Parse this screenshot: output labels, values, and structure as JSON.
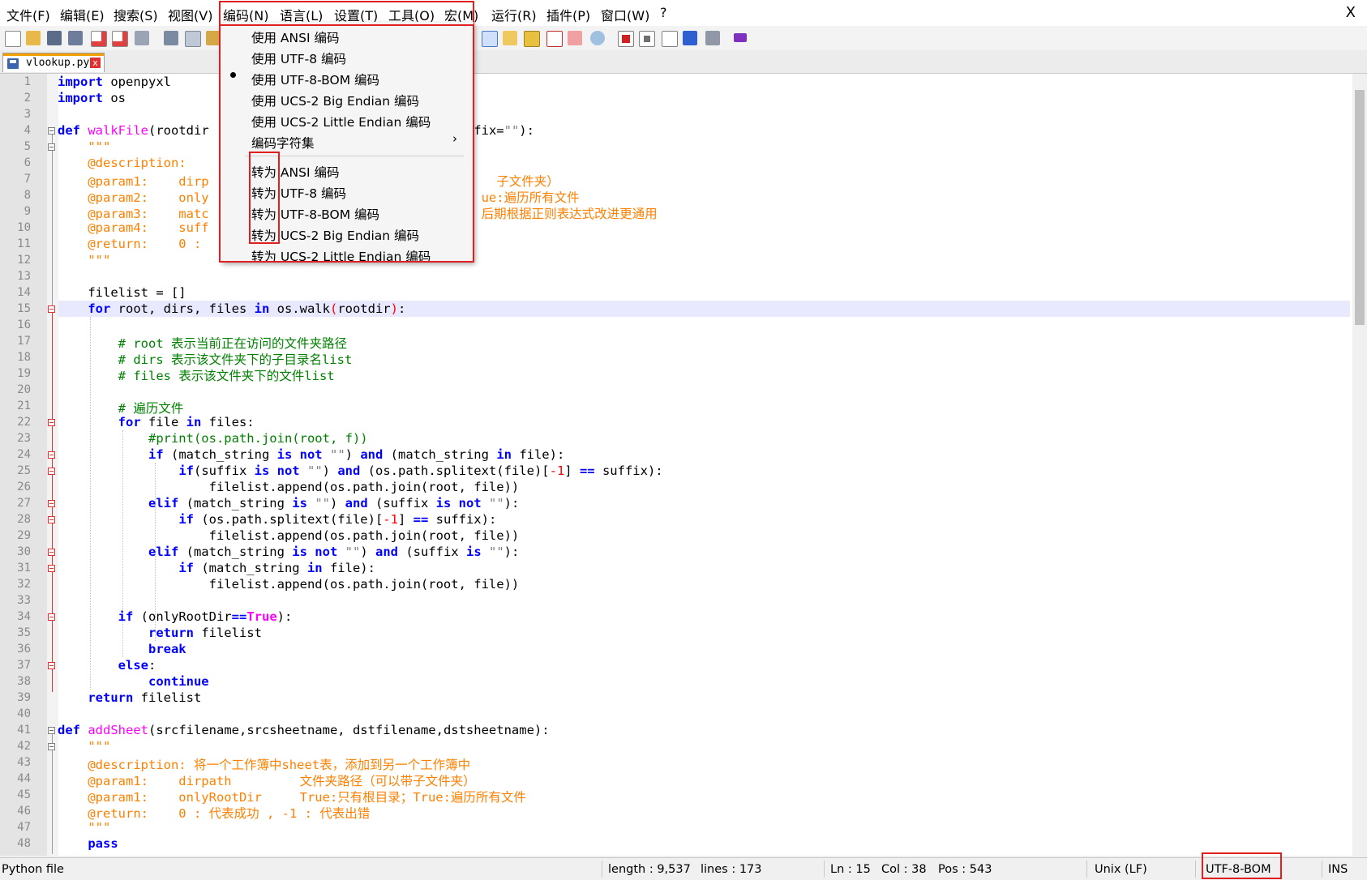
{
  "menu": {
    "file": "文件(F)",
    "edit": "编辑(E)",
    "search": "搜索(S)",
    "view": "视图(V)",
    "encoding": "编码(N)",
    "language": "语言(L)",
    "settings": "设置(T)",
    "tools": "工具(O)",
    "macro": "宏(M)",
    "run": "运行(R)",
    "plugins": "插件(P)",
    "window": "窗口(W)",
    "help": "?",
    "close": "X"
  },
  "tab": {
    "filename": "vlookup.py",
    "close": "x"
  },
  "encoding_menu": {
    "use_ansi": "使用 ANSI 编码",
    "use_utf8": "使用 UTF-8 编码",
    "use_utf8_bom": "使用 UTF-8-BOM 编码",
    "use_ucs2_be": "使用 UCS-2 Big Endian 编码",
    "use_ucs2_le": "使用 UCS-2 Little Endian 编码",
    "charset": "编码字符集",
    "charset_arrow": "›",
    "conv_ansi": "转为 ANSI 编码",
    "conv_utf8": "转为 UTF-8 编码",
    "conv_utf8_bom": "转为 UTF-8-BOM 编码",
    "conv_ucs2_be": "转为 UCS-2 Big Endian 编码",
    "conv_ucs2_le": "转为 UCS-2 Little Endian 编码",
    "selected": "use_utf8_bom"
  },
  "editor": {
    "line_numbers": [
      "1",
      "2",
      "3",
      "4",
      "5",
      "6",
      "7",
      "8",
      "9",
      "10",
      "11",
      "12",
      "13",
      "14",
      "15",
      "16",
      "17",
      "18",
      "19",
      "20",
      "21",
      "22",
      "23",
      "24",
      "25",
      "26",
      "27",
      "28",
      "29",
      "30",
      "31",
      "32",
      "33",
      "34",
      "35",
      "36",
      "37",
      "38",
      "39",
      "40",
      "41",
      "42",
      "43",
      "44",
      "45",
      "46",
      "47",
      "48"
    ],
    "current_line": "15"
  },
  "status": {
    "filetype": "Python file",
    "length": "length : 9,537",
    "lines": "lines : 173",
    "ln": "Ln : 15",
    "col": "Col : 38",
    "pos": "Pos : 543",
    "eol": "Unix (LF)",
    "encoding": "UTF-8-BOM",
    "mode": "INS"
  },
  "colors": {
    "keyword": "#0000ff",
    "function_name": "#ff00ff",
    "comment": "#008000",
    "string": "#808080",
    "docstring": "#ff8000",
    "number": "#ff0000",
    "highlight_box": "#e02020",
    "current_line": "#e8e8ff"
  },
  "icons": [
    "new-file-icon",
    "open-file-icon",
    "save-icon",
    "save-all-icon",
    "close-icon",
    "close-all-icon",
    "print-icon",
    "cut-icon",
    "copy-icon",
    "paste-icon",
    "word-wrap-icon",
    "show-all-chars-icon",
    "indent-guide-icon",
    "function-list-icon",
    "folder-workspace-icon",
    "monitor-icon",
    "record-macro-icon",
    "stop-record-icon",
    "play-macro-icon",
    "run-macro-multiple-icon",
    "save-macro-icon",
    "markdown-icon"
  ]
}
